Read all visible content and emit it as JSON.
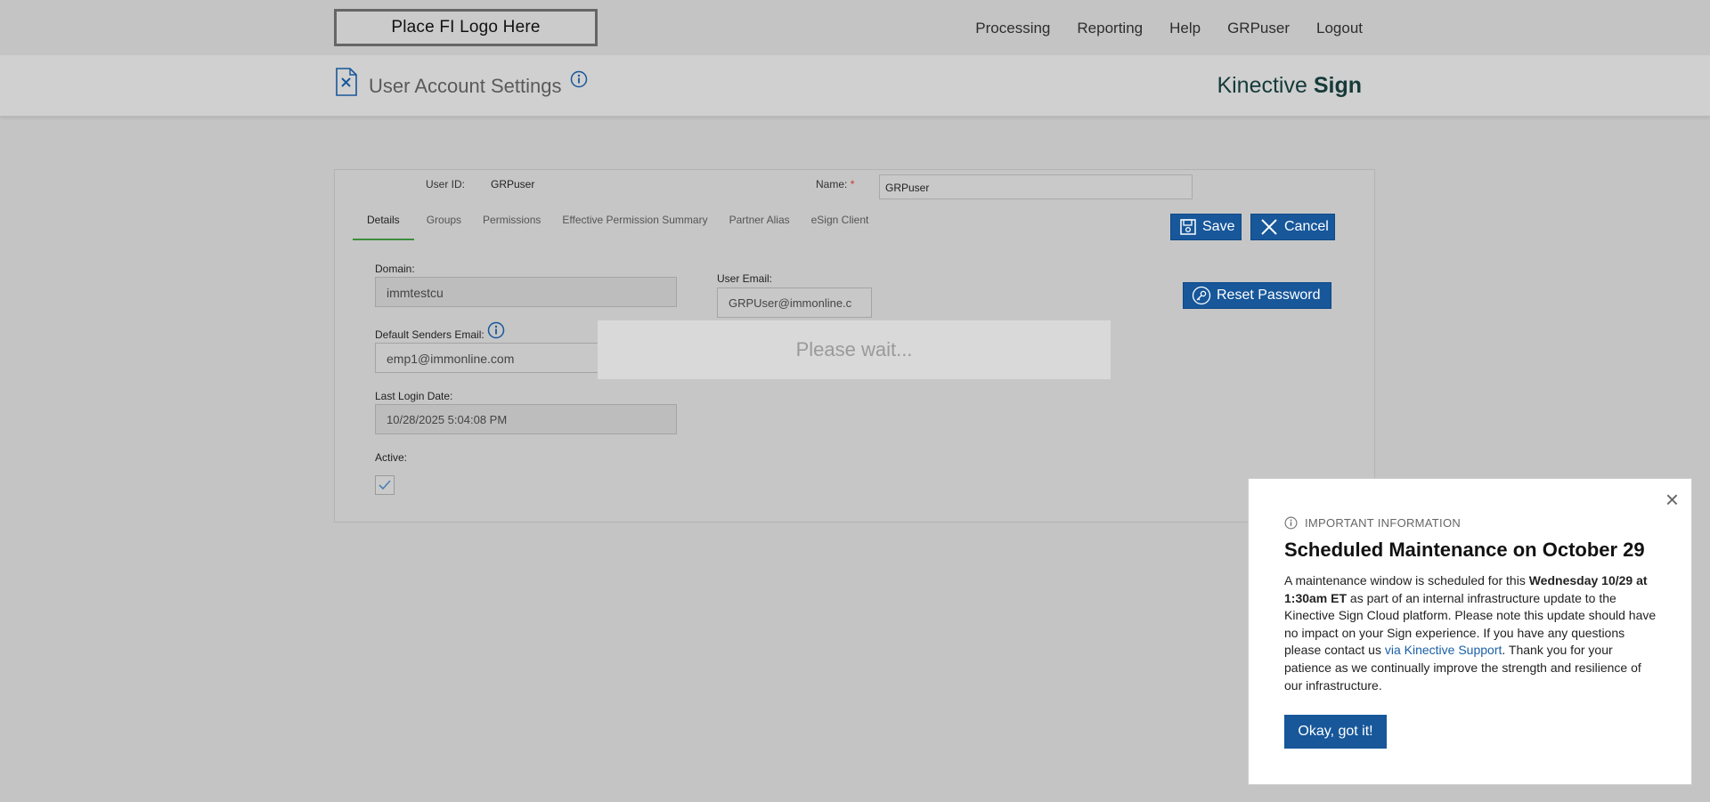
{
  "header": {
    "logo_text": "Place FI Logo Here",
    "nav": [
      "Processing",
      "Reporting",
      "Help",
      "GRPuser",
      "Logout"
    ]
  },
  "title_band": {
    "title": "User Account Settings",
    "brand_regular": "Kinective ",
    "brand_bold": "Sign"
  },
  "form": {
    "user_id_label": "User ID:",
    "user_id_value": "GRPuser",
    "name_label": "Name:",
    "name_required": "*",
    "name_value": "GRPuser",
    "tabs": [
      "Details",
      "Groups",
      "Permissions",
      "Effective Permission Summary",
      "Partner Alias",
      "eSign Client"
    ],
    "save_label": "Save",
    "cancel_label": "Cancel",
    "reset_password_label": "Reset Password",
    "domain_label": "Domain:",
    "domain_value": "immtestcu",
    "user_email_label": "User Email:",
    "user_email_value": "GRPUser@immonline.c",
    "default_senders_label": "Default Senders Email:",
    "default_senders_value": "emp1@immonline.com",
    "last_login_label": "Last Login Date:",
    "last_login_value": "10/28/2025 5:04:08 PM",
    "active_label": "Active:"
  },
  "overlay": {
    "wait_text": "Please wait..."
  },
  "modal": {
    "close_glyph": "×",
    "kicker": "IMPORTANT INFORMATION",
    "title": "Scheduled Maintenance on October 29",
    "body_1": "A maintenance window is scheduled for this ",
    "body_bold": "Wednesday 10/29 at 1:30am ET",
    "body_2": " as part of an internal infrastructure update to the Kinective Sign Cloud platform. Please note this update should have no impact on your Sign experience. If you have any questions please contact us ",
    "body_link": "via Kinective Support",
    "body_3": ". Thank you for your patience as we continually improve the strength and resilience of our infrastructure.",
    "ok_label": "Okay, got it!"
  },
  "colors": {
    "primary": "#17579a",
    "tab_active_underline": "#3e8e3e",
    "link": "#1a5fa8"
  }
}
